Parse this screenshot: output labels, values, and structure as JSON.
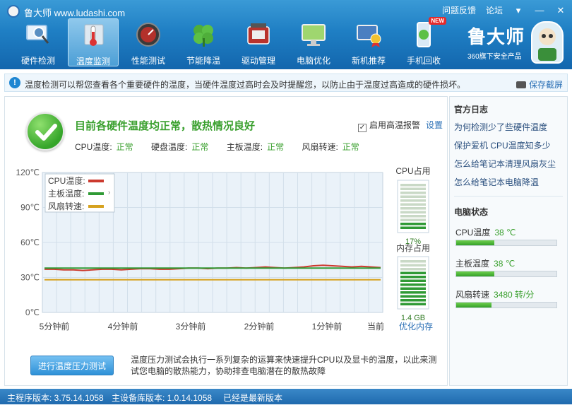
{
  "app": {
    "title": "鲁大师 www.ludashi.com"
  },
  "top_links": {
    "feedback": "问题反馈",
    "forum": "论坛",
    "menu": "▾",
    "minimize": "—",
    "close": "✕"
  },
  "tabs": [
    {
      "label": "硬件检测",
      "icon": "monitor-magnifier-icon",
      "color": "#5a8fc2"
    },
    {
      "label": "温度监测",
      "icon": "thermometer-icon",
      "color": "#c94b3a"
    },
    {
      "label": "性能测试",
      "icon": "speedometer-icon",
      "color": "#b3312b"
    },
    {
      "label": "节能降温",
      "icon": "clover-icon",
      "color": "#4fae3a"
    },
    {
      "label": "驱动管理",
      "icon": "driver-chip-icon",
      "color": "#b8332d"
    },
    {
      "label": "电脑优化",
      "icon": "desktop-optimize-icon",
      "color": "#6ba43a"
    },
    {
      "label": "新机推荐",
      "icon": "pc-award-icon",
      "color": "#4a7fc1"
    },
    {
      "label": "手机回收",
      "icon": "phone-recycle-icon",
      "color": "#d9e9f6",
      "badge": "NEW"
    }
  ],
  "brand": {
    "name": "鲁大师",
    "sub": "360旗下安全产品"
  },
  "info": {
    "text": "温度检测可以帮您查看各个重要硬件的温度，当硬件温度过高时会及时提醒您，以防止由于温度过高造成的硬件损坏。",
    "save": "保存截屏"
  },
  "status": {
    "title": "目前各硬件温度均正常，散热情况良好",
    "items": [
      {
        "label": "CPU温度:",
        "value": "正常"
      },
      {
        "label": "硬盘温度:",
        "value": "正常"
      },
      {
        "label": "主板温度:",
        "value": "正常"
      },
      {
        "label": "风扇转速:",
        "value": "正常"
      }
    ],
    "alarm": "启用高温报警",
    "settings": "设置"
  },
  "chart_data": {
    "type": "line",
    "yticks": [
      "120℃",
      "90℃",
      "60℃",
      "30℃",
      "0℃"
    ],
    "ylim": [
      0,
      120
    ],
    "xticks": [
      "5分钟前",
      "4分钟前",
      "3分钟前",
      "2分钟前",
      "1分钟前",
      "当前"
    ],
    "legend": [
      "CPU温度:",
      "主板温度:",
      "风扇转速:"
    ],
    "legend_colors": [
      "#cc3a2e",
      "#2f9a35",
      "#d6a21f"
    ],
    "series": [
      {
        "name": "CPU温度:",
        "color": "#cc3a2e",
        "values": [
          37,
          37,
          36.5,
          36.5,
          36,
          36.5,
          37,
          37,
          36.5,
          37,
          37.5,
          37.5,
          37,
          37,
          37.5,
          38,
          38,
          37.5,
          38,
          38,
          38.5,
          38,
          38.5,
          39,
          38.5,
          38,
          38.5,
          39,
          40,
          40.5,
          40,
          39.5,
          39,
          39.5,
          39,
          38.5
        ]
      },
      {
        "name": "主板温度:",
        "color": "#2f9a35",
        "values": [
          38,
          38,
          38,
          38,
          38,
          38,
          38,
          38,
          38,
          38,
          38,
          38,
          38,
          38,
          38,
          38,
          38,
          38,
          38,
          38,
          38,
          38,
          38,
          38,
          38,
          38,
          38,
          38,
          38,
          38,
          38,
          38,
          38,
          38,
          38,
          38
        ]
      },
      {
        "name": "风扇转速:",
        "color": "#d6a21f",
        "values": [
          28,
          28,
          28,
          28,
          28,
          28,
          28,
          28,
          28,
          28,
          28,
          28,
          28,
          28,
          28,
          28,
          28,
          28,
          28,
          28,
          28,
          28,
          28,
          28,
          28,
          28,
          28,
          28,
          28,
          28,
          28,
          28,
          28,
          28,
          28,
          28
        ]
      }
    ],
    "grid": true
  },
  "gauges": {
    "cpu_title": "CPU占用",
    "cpu_value": "17%",
    "cpu_fraction": 0.17,
    "mem_title": "内存占用",
    "mem_value": "1.4 GB",
    "mem_fraction": 0.75,
    "optimize": "优化内存"
  },
  "stress": {
    "button": "进行温度压力测试",
    "desc": "温度压力测试会执行一系列复杂的运算来快速提升CPU以及显卡的温度，以此来测试您电脑的散热能力，协助排查电脑潜在的散热故障"
  },
  "side": {
    "log_title": "官方日志",
    "links": [
      "为何检测少了些硬件温度",
      "保护爱机 CPU温度知多少",
      "怎么给笔记本清理风扇灰尘",
      "怎么给笔记本电脑降温"
    ],
    "state_title": "电脑状态",
    "stats": [
      {
        "label": "CPU温度",
        "value": "38 ℃",
        "fraction": 0.38
      },
      {
        "label": "主板温度",
        "value": "38 ℃",
        "fraction": 0.38
      },
      {
        "label": "风扇转速",
        "value": "3480 转/分",
        "fraction": 0.35
      }
    ]
  },
  "statusbar": {
    "main_ver": "主程序版本: 3.75.14.1058",
    "db_ver": "主设备库版本: 1.0.14.1058",
    "latest": "已经是最新版本"
  }
}
